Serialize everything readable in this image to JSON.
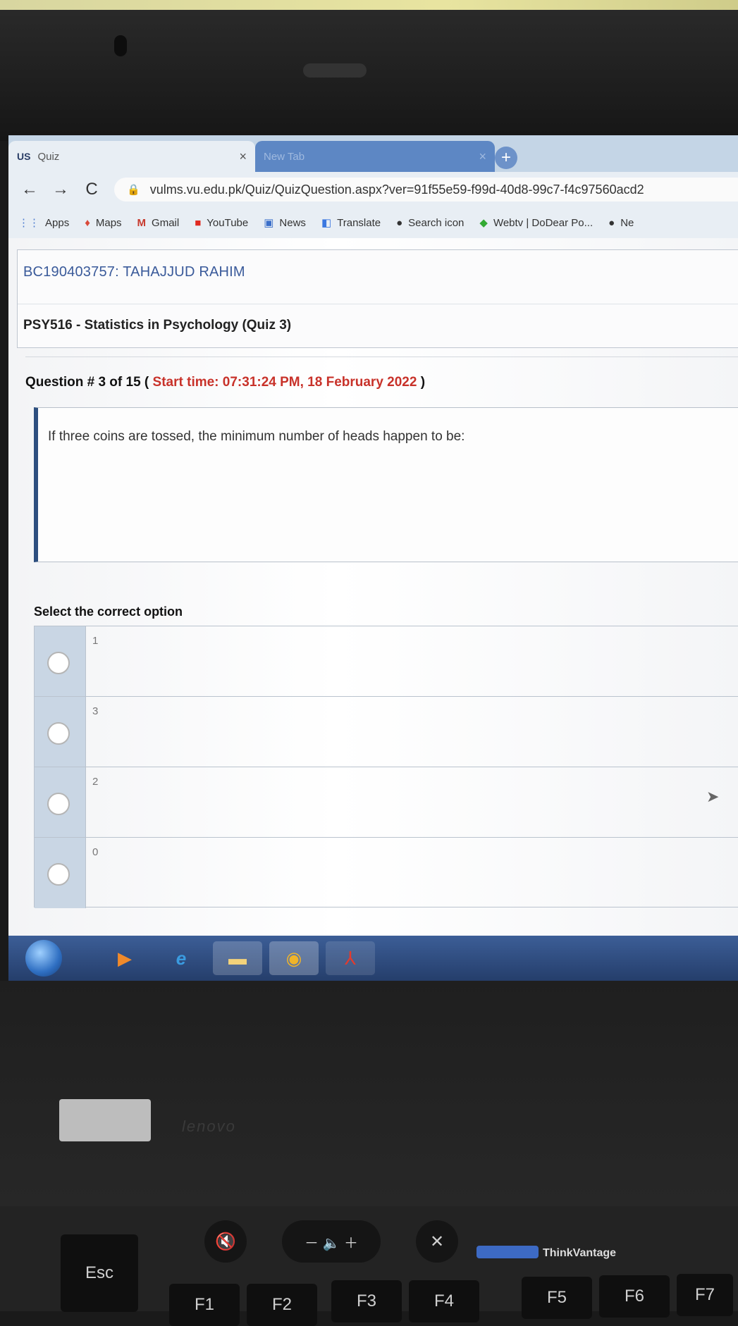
{
  "browser": {
    "tabs": [
      {
        "favicon": "US",
        "title": "Quiz",
        "close": "×"
      },
      {
        "title": "New Tab",
        "close": "×"
      }
    ],
    "new_tab": "+",
    "nav": {
      "back": "←",
      "forward": "→",
      "reload": "C"
    },
    "url": "vulms.vu.edu.pk/Quiz/QuizQuestion.aspx?ver=91f55e59-f99d-40d8-99c7-f4c97560acd2",
    "bookmarks": [
      {
        "icon": "apps-grid-icon",
        "label": "Apps"
      },
      {
        "icon": "maps-icon",
        "label": "Maps"
      },
      {
        "icon": "gmail-icon",
        "label": "Gmail"
      },
      {
        "icon": "youtube-icon",
        "label": "YouTube"
      },
      {
        "icon": "news-icon",
        "label": "News"
      },
      {
        "icon": "translate-icon",
        "label": "Translate"
      },
      {
        "icon": "globe-icon",
        "label": "Search icon"
      },
      {
        "icon": "bookmark-icon",
        "label": "Webtv | DoDear Po..."
      },
      {
        "icon": "globe-icon",
        "label": "Ne"
      }
    ]
  },
  "quiz": {
    "student": "BC190403757: TAHAJJUD RAHIM",
    "course": "PSY516 - Statistics in Psychology (Quiz 3)",
    "question_prefix": "Question # 3 of 15 (",
    "start_time": "Start time: 07:31:24 PM, 18 February 2022",
    "question_suffix": ")",
    "question_text": "If three coins are tossed, the minimum number of heads happen to be:",
    "select_label": "Select the correct option",
    "options": [
      "1",
      "3",
      "2",
      "0"
    ]
  },
  "laptop": {
    "brand": "lenovo",
    "thinkvantage": "ThinkVantage",
    "keys": [
      "Esc",
      "F1",
      "F2",
      "F3",
      "F4",
      "F5",
      "F6",
      "F7"
    ]
  }
}
